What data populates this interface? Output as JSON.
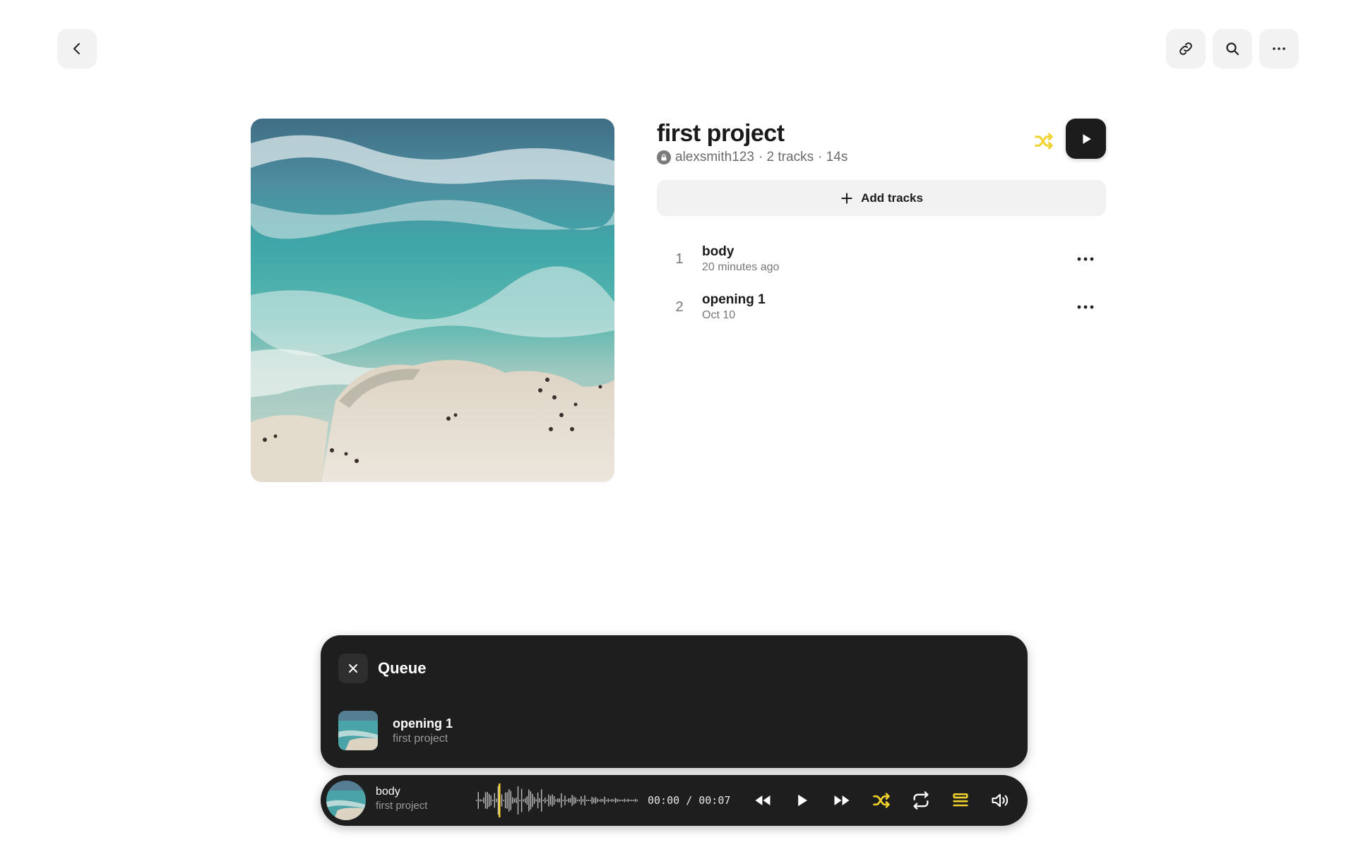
{
  "project": {
    "title": "first project",
    "owner": "alexsmith123",
    "track_count": "· 2 tracks",
    "duration": "· 14s",
    "add_tracks_label": "Add tracks"
  },
  "tracks": [
    {
      "number": "1",
      "name": "body",
      "date": "20 minutes ago"
    },
    {
      "number": "2",
      "name": "opening 1",
      "date": "Oct 10"
    }
  ],
  "queue": {
    "title": "Queue",
    "items": [
      {
        "name": "opening 1",
        "subtitle": "first project"
      }
    ]
  },
  "player": {
    "track_name": "body",
    "project_name": "first project",
    "current_time": "00:00",
    "total_time": "00:07",
    "separator": "/",
    "progress": 0.0
  },
  "colors": {
    "accent": "#f2d22e",
    "dark": "#1e1e1e",
    "button_bg": "#f2f2f2"
  },
  "icons": {
    "back": "chevron-left-icon",
    "link": "link-icon",
    "search": "search-icon",
    "more": "more-horizontal-icon",
    "shuffle": "shuffle-icon",
    "play": "play-icon",
    "rewind": "rewind-icon",
    "fast_forward": "fast-forward-icon",
    "repeat": "repeat-icon",
    "queue": "queue-icon",
    "volume": "volume-icon",
    "close": "close-icon",
    "plus": "plus-icon",
    "lock": "lock-icon"
  }
}
